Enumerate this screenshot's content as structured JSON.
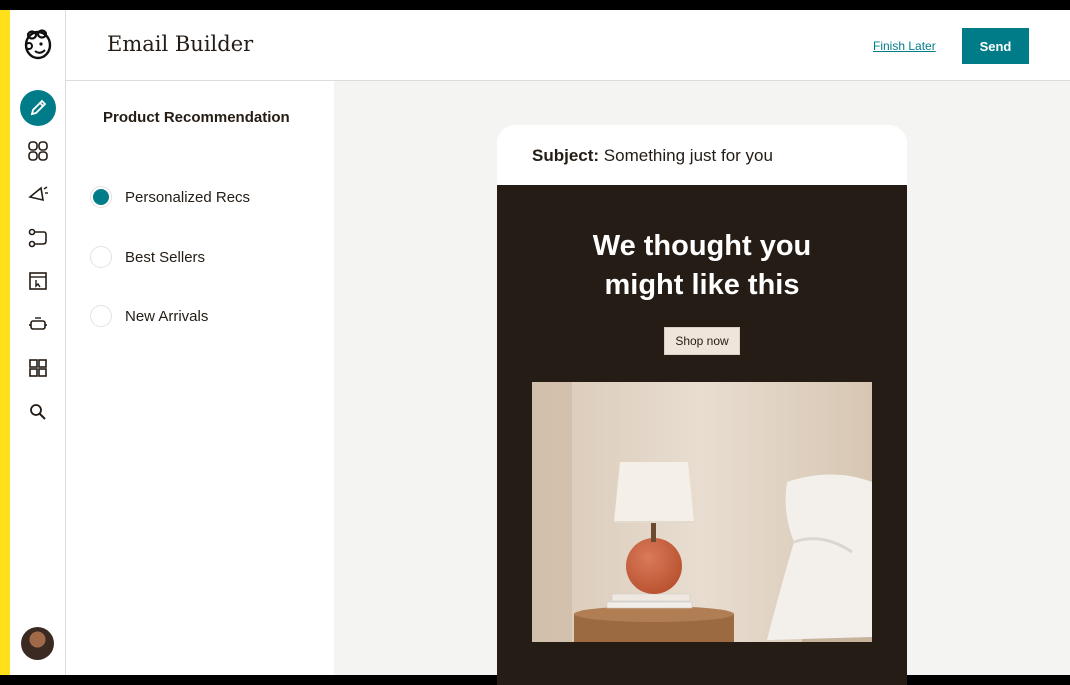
{
  "header": {
    "title": "Email Builder",
    "finish_later": "Finish Later",
    "send": "Send"
  },
  "nav": {
    "items": [
      "pencil-icon",
      "audience-icon",
      "campaigns-icon",
      "automations-icon",
      "website-icon",
      "integrations-icon",
      "content-icon",
      "search-icon"
    ],
    "active": "pencil-icon"
  },
  "panel": {
    "title": "Product Recommendation",
    "options": [
      {
        "label": "Personalized Recs",
        "selected": true
      },
      {
        "label": "Best Sellers",
        "selected": false
      },
      {
        "label": "New Arrivals",
        "selected": false
      }
    ]
  },
  "email": {
    "subject_label": "Subject:",
    "subject_value": "Something just for you",
    "headline_line1": "We thought you",
    "headline_line2": "might like this",
    "cta": "Shop now"
  },
  "colors": {
    "accent": "#007c89",
    "brand_yellow": "#ffe01b",
    "email_bg": "#241c15",
    "canvas_bg": "#f4f4f2"
  }
}
